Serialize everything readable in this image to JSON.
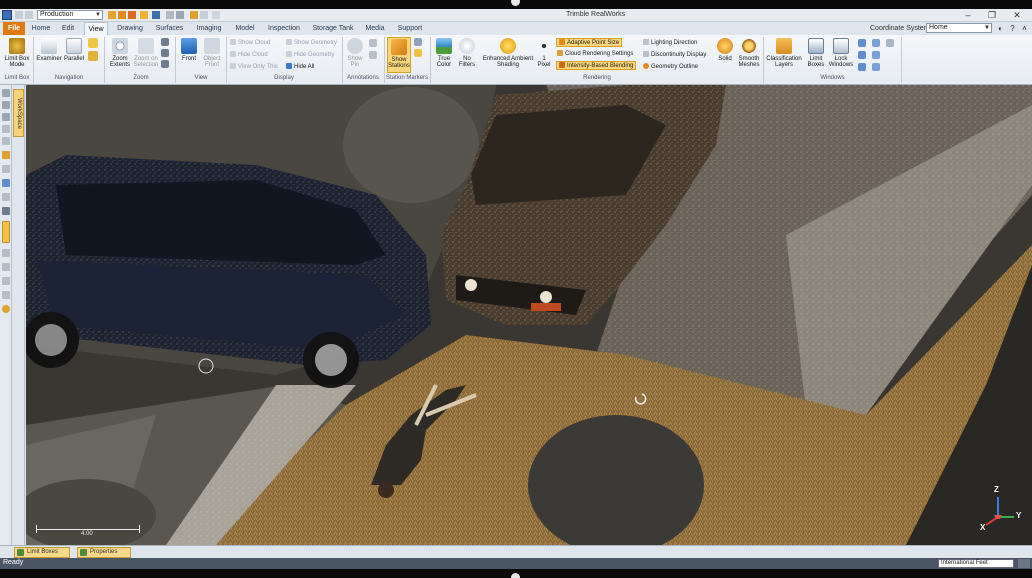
{
  "window": {
    "title": "Trimble RealWorks",
    "profile": "Production"
  },
  "menu": {
    "tabs": [
      "File",
      "Home",
      "Edit",
      "View",
      "Drawing",
      "Surfaces",
      "Imaging",
      "Model",
      "Inspection",
      "Storage Tank",
      "Media",
      "Support"
    ],
    "active_tab": "View",
    "coordinate_system_label": "Coordinate System",
    "coordinate_system_value": "Home"
  },
  "ribbon": {
    "limit_box": {
      "group": "Limit Box",
      "mode_label": "Limit Box Mode"
    },
    "navigation": {
      "group": "Navigation",
      "examiner": "Examiner",
      "parallel": "Parallel"
    },
    "zoom": {
      "group": "Zoom",
      "extents": "Zoom Extents",
      "selection": "Zoom on Selection"
    },
    "view": {
      "group": "View",
      "front": "Front",
      "object_front": "Object Front"
    },
    "display": {
      "group": "Display",
      "show_cloud": "Show Cloud",
      "hide_cloud": "Hide Cloud",
      "view_only_this": "View Only This",
      "show_geometry": "Show Geometry",
      "hide_geometry": "Hide Geometry",
      "hide_all": "Hide All"
    },
    "annotations": {
      "group": "Annotations",
      "show_pin": "Show Pin"
    },
    "station_markers": {
      "group": "Station Markers",
      "show_stations": "Show Stations"
    },
    "rendering": {
      "group": "Rendering",
      "true_color": "True Color",
      "no_filters": "No Filters",
      "ambient": "Enhanced Ambient Shading",
      "pixel": "1 Pixel",
      "adaptive_point_size": "Adaptive Point Size",
      "cloud_rendering_settings": "Cloud Rendering Settings",
      "intensity_based_blending": "Intensity-Based Blending",
      "lighting_direction": "Lighting Direction",
      "discontinuity_display": "Discontinuity Display",
      "geometry_outline": "Geometry Outline",
      "solid": "Solid",
      "smooth_meshes": "Smooth Meshes"
    },
    "windows": {
      "group": "Windows",
      "classification_layers": "Classification Layers",
      "limit_boxes": "Limit Boxes",
      "lock_windows": "Lock Windows"
    }
  },
  "sidebar": {
    "workspace_tab": "WorkSpace"
  },
  "viewport": {
    "scale_value": "4.00",
    "axes": {
      "x": "X",
      "y": "Y",
      "z": "Z"
    }
  },
  "bottom_tabs": [
    "Limit Boxes",
    "Properties"
  ],
  "status": {
    "text": "Ready",
    "units": "International Feet"
  },
  "colors": {
    "accent_orange": "#e07a10",
    "highlight_yellow": "#fbd67a",
    "status_bar": "#4a5565"
  }
}
